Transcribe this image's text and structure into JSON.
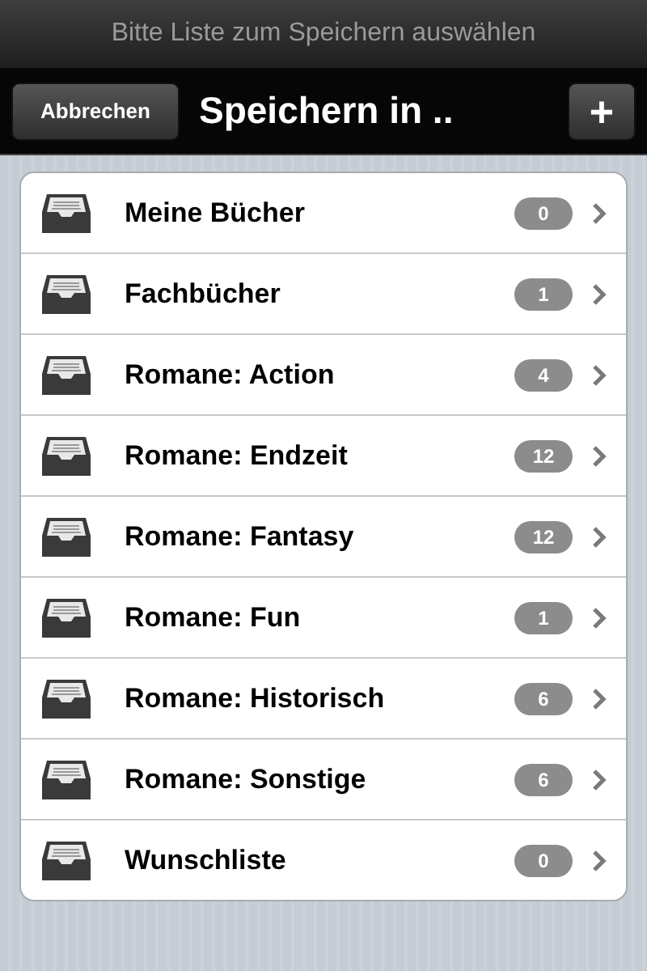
{
  "prompt": "Bitte Liste zum Speichern auswählen",
  "nav_bar": {
    "cancel_button": "Abbrechen",
    "title": "Speichern in ..",
    "add_button": "+"
  },
  "lists": [
    {
      "name": "Meine Bücher",
      "count": "0"
    },
    {
      "name": "Fachbücher",
      "count": "1"
    },
    {
      "name": "Romane: Action",
      "count": "4"
    },
    {
      "name": "Romane: Endzeit",
      "count": "12"
    },
    {
      "name": "Romane: Fantasy",
      "count": "12"
    },
    {
      "name": "Romane: Fun",
      "count": "1"
    },
    {
      "name": "Romane: Historisch",
      "count": "6"
    },
    {
      "name": "Romane: Sonstige",
      "count": "6"
    },
    {
      "name": "Wunschliste",
      "count": "0"
    }
  ]
}
